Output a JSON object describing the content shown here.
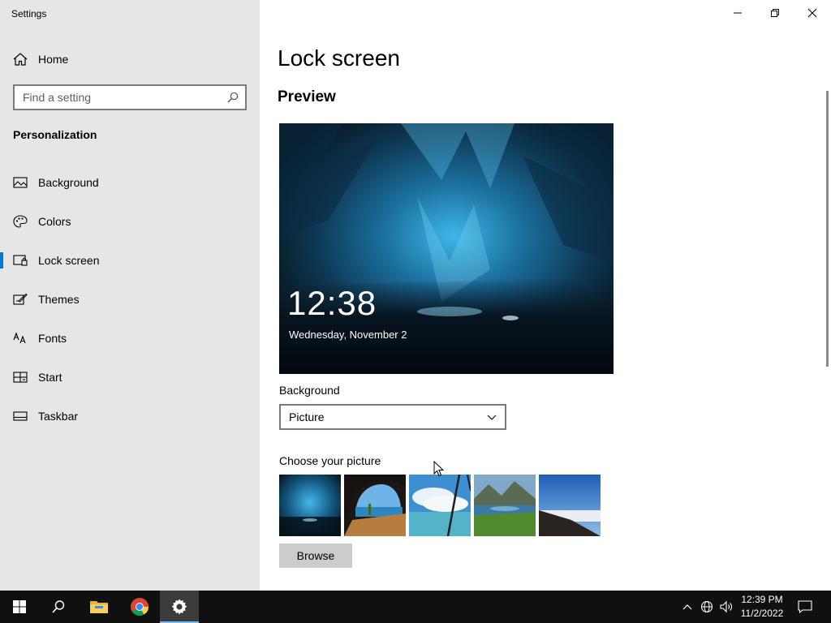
{
  "window": {
    "title": "Settings",
    "minimize_icon": "minimize-icon",
    "restore_icon": "restore-icon",
    "close_icon": "close-icon"
  },
  "sidebar": {
    "home_label": "Home",
    "search_placeholder": "Find a setting",
    "section_title": "Personalization",
    "items": [
      {
        "label": "Background",
        "icon": "picture-icon",
        "active": false
      },
      {
        "label": "Colors",
        "icon": "palette-icon",
        "active": false
      },
      {
        "label": "Lock screen",
        "icon": "lock-screen-icon",
        "active": true
      },
      {
        "label": "Themes",
        "icon": "brush-icon",
        "active": false
      },
      {
        "label": "Fonts",
        "icon": "font-icon",
        "active": false
      },
      {
        "label": "Start",
        "icon": "start-icon",
        "active": false
      },
      {
        "label": "Taskbar",
        "icon": "taskbar-icon",
        "active": false
      }
    ],
    "accent_color": "#0078d7"
  },
  "main": {
    "title": "Lock screen",
    "preview_heading": "Preview",
    "preview_time": "12:38",
    "preview_date": "Wednesday, November 2",
    "background_label": "Background",
    "background_value": "Picture",
    "choose_label": "Choose your picture",
    "browse_label": "Browse"
  },
  "taskbar": {
    "apps": [
      "start-icon",
      "search-icon",
      "file-explorer-icon",
      "chrome-icon",
      "settings-icon"
    ],
    "active_app": "settings-icon",
    "tray_icons": [
      "chevron-up-icon",
      "network-icon",
      "volume-icon"
    ],
    "time": "12:39 PM",
    "date": "11/2/2022",
    "notification_icon": "notification-icon"
  }
}
